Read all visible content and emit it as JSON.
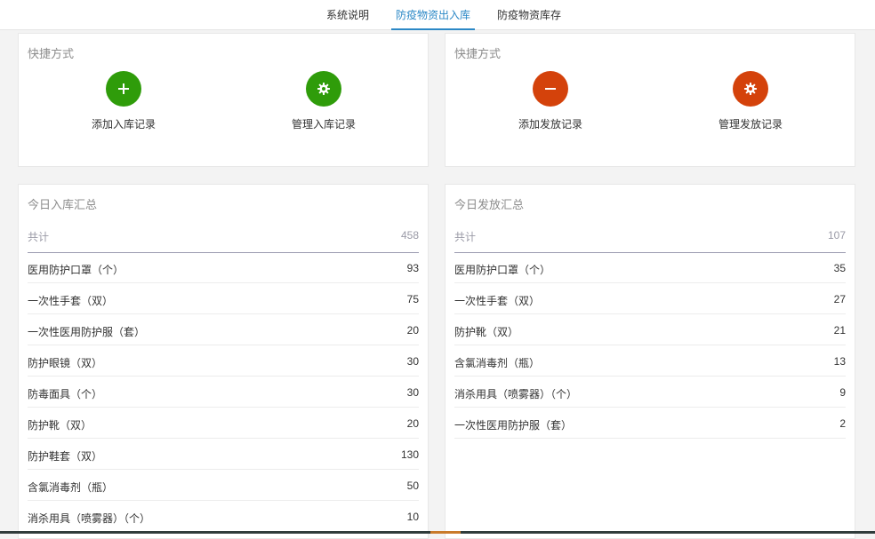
{
  "tabs": [
    {
      "label": "系统说明",
      "active": false
    },
    {
      "label": "防疫物资出入库",
      "active": true
    },
    {
      "label": "防疫物资库存",
      "active": false
    }
  ],
  "colors": {
    "accent": "#2b88c6",
    "green": "#2f9c0a",
    "red": "#d4420b"
  },
  "shortcuts_in": {
    "title": "快捷方式",
    "items": [
      {
        "label": "添加入库记录",
        "icon": "plus-icon"
      },
      {
        "label": "管理入库记录",
        "icon": "gear-icon"
      }
    ]
  },
  "shortcuts_out": {
    "title": "快捷方式",
    "items": [
      {
        "label": "添加发放记录",
        "icon": "minus-icon"
      },
      {
        "label": "管理发放记录",
        "icon": "gear-icon"
      }
    ]
  },
  "inbound": {
    "title": "今日入库汇总",
    "total_label": "共计",
    "total": "458",
    "rows": [
      {
        "name": "医用防护口罩（个）",
        "value": "93"
      },
      {
        "name": "一次性手套（双）",
        "value": "75"
      },
      {
        "name": "一次性医用防护服（套）",
        "value": "20"
      },
      {
        "name": "防护眼镜（双）",
        "value": "30"
      },
      {
        "name": "防毒面具（个）",
        "value": "30"
      },
      {
        "name": "防护靴（双）",
        "value": "20"
      },
      {
        "name": "防护鞋套（双）",
        "value": "130"
      },
      {
        "name": "含氯消毒剂（瓶）",
        "value": "50"
      },
      {
        "name": "消杀用具（喷雾器）（个）",
        "value": "10"
      }
    ]
  },
  "outbound": {
    "title": "今日发放汇总",
    "total_label": "共计",
    "total": "107",
    "rows": [
      {
        "name": "医用防护口罩（个）",
        "value": "35"
      },
      {
        "name": "一次性手套（双）",
        "value": "27"
      },
      {
        "name": "防护靴（双）",
        "value": "21"
      },
      {
        "name": "含氯消毒剂（瓶）",
        "value": "13"
      },
      {
        "name": "消杀用具（喷雾器）（个）",
        "value": "9"
      },
      {
        "name": "一次性医用防护服（套）",
        "value": "2"
      }
    ]
  }
}
